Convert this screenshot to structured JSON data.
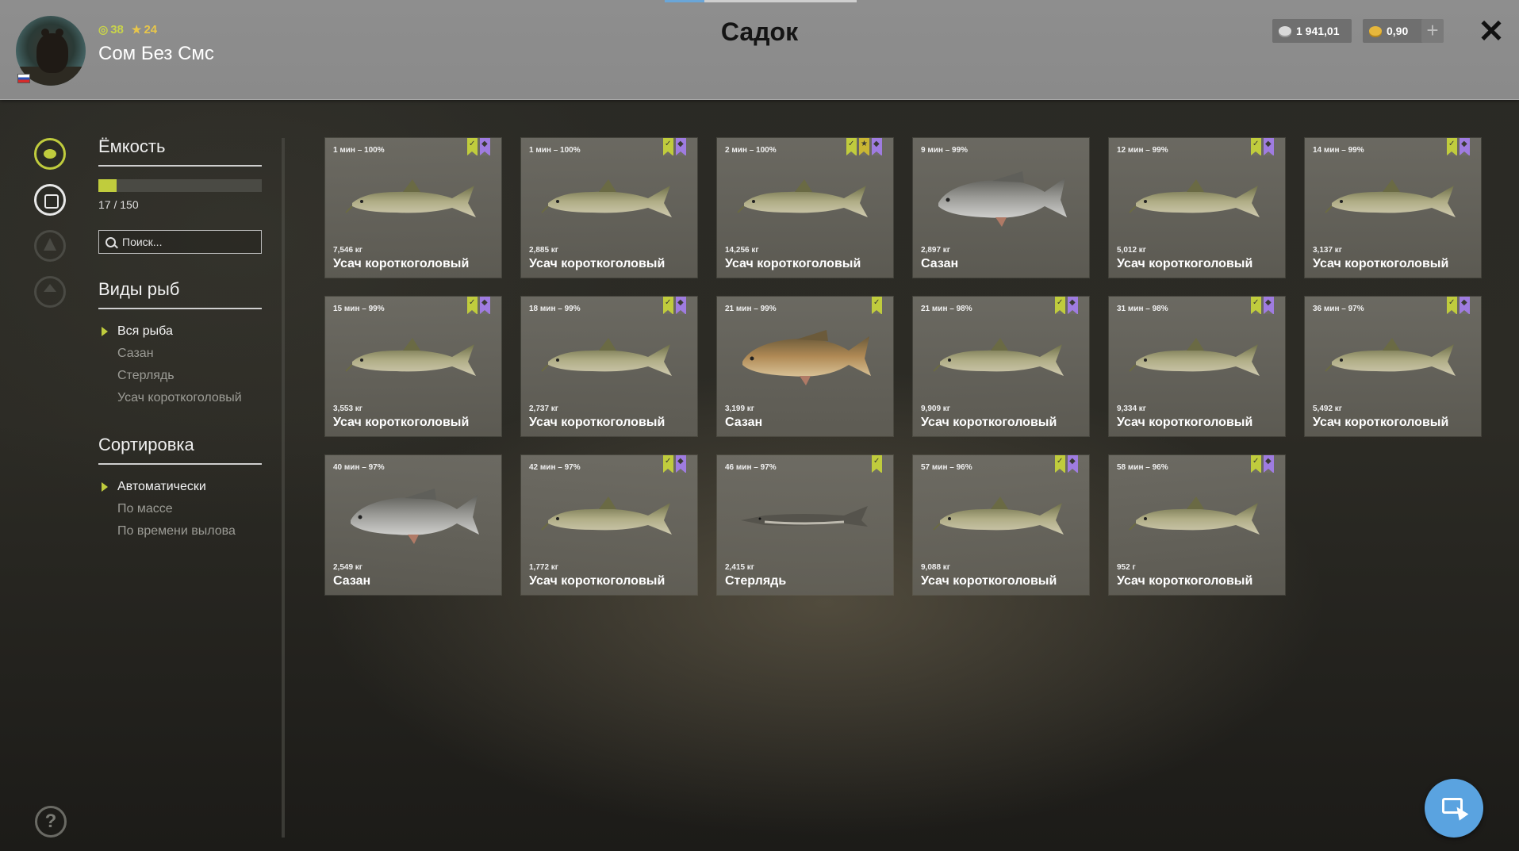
{
  "header": {
    "title": "Садок",
    "player": {
      "name": "Сом Без Смс",
      "level": "38",
      "stars": "24"
    },
    "currency": {
      "silver": "1 941,01",
      "gold": "0,90"
    },
    "add_label": "+",
    "close_label": "✕"
  },
  "sidebar": {
    "capacity": {
      "title": "Ёмкость",
      "value": 17,
      "max": 150,
      "text": "17 / 150",
      "fill_fraction": 0.1133
    },
    "search": {
      "placeholder": "Поиск..."
    },
    "species": {
      "title": "Виды рыб",
      "items": [
        {
          "label": "Вся рыба",
          "active": true
        },
        {
          "label": "Сазан",
          "active": false
        },
        {
          "label": "Стерлядь",
          "active": false
        },
        {
          "label": "Усач короткоголовый",
          "active": false
        }
      ]
    },
    "sorting": {
      "title": "Сортировка",
      "items": [
        {
          "label": "Автоматически",
          "active": true
        },
        {
          "label": "По массе",
          "active": false
        },
        {
          "label": "По времени вылова",
          "active": false
        }
      ]
    },
    "help_label": "?"
  },
  "colors": {
    "accent": "#c0cc3d",
    "badge_purple": "#9f7ce0",
    "badge_gold": "#c9b634",
    "button_blue": "#5aa3e0"
  },
  "fish": [
    {
      "time": "1 мин – 100%",
      "weight": "7,546 кг",
      "name": "Усач короткоголовый",
      "kind": "barbel",
      "badges": [
        "green",
        "purple"
      ]
    },
    {
      "time": "1 мин – 100%",
      "weight": "2,885 кг",
      "name": "Усач короткоголовый",
      "kind": "barbel",
      "badges": [
        "green",
        "purple"
      ]
    },
    {
      "time": "2 мин – 100%",
      "weight": "14,256 кг",
      "name": "Усач короткоголовый",
      "kind": "barbel",
      "badges": [
        "green",
        "gold",
        "purple"
      ]
    },
    {
      "time": "9 мин – 99%",
      "weight": "2,897 кг",
      "name": "Сазан",
      "kind": "carp",
      "badges": []
    },
    {
      "time": "12 мин – 99%",
      "weight": "5,012 кг",
      "name": "Усач короткоголовый",
      "kind": "barbel",
      "badges": [
        "green",
        "purple"
      ]
    },
    {
      "time": "14 мин – 99%",
      "weight": "3,137 кг",
      "name": "Усач короткоголовый",
      "kind": "barbel",
      "badges": [
        "green",
        "purple"
      ]
    },
    {
      "time": "15 мин – 99%",
      "weight": "3,553 кг",
      "name": "Усач короткоголовый",
      "kind": "barbel",
      "badges": [
        "green",
        "purple"
      ]
    },
    {
      "time": "18 мин – 99%",
      "weight": "2,737 кг",
      "name": "Усач короткоголовый",
      "kind": "barbel",
      "badges": [
        "green",
        "purple"
      ]
    },
    {
      "time": "21 мин – 99%",
      "weight": "3,199 кг",
      "name": "Сазан",
      "kind": "carp-golden",
      "badges": [
        "green"
      ]
    },
    {
      "time": "21 мин – 98%",
      "weight": "9,909 кг",
      "name": "Усач короткоголовый",
      "kind": "barbel",
      "badges": [
        "green",
        "purple"
      ]
    },
    {
      "time": "31 мин – 98%",
      "weight": "9,334 кг",
      "name": "Усач короткоголовый",
      "kind": "barbel",
      "badges": [
        "green",
        "purple"
      ]
    },
    {
      "time": "36 мин – 97%",
      "weight": "5,492 кг",
      "name": "Усач короткоголовый",
      "kind": "barbel",
      "badges": [
        "green",
        "purple"
      ]
    },
    {
      "time": "40 мин – 97%",
      "weight": "2,549 кг",
      "name": "Сазан",
      "kind": "carp",
      "badges": []
    },
    {
      "time": "42 мин – 97%",
      "weight": "1,772 кг",
      "name": "Усач короткоголовый",
      "kind": "barbel",
      "badges": [
        "green",
        "purple"
      ]
    },
    {
      "time": "46 мин – 97%",
      "weight": "2,415 кг",
      "name": "Стерлядь",
      "kind": "sterlet",
      "badges": [
        "green"
      ]
    },
    {
      "time": "57 мин – 96%",
      "weight": "9,088 кг",
      "name": "Усач короткоголовый",
      "kind": "barbel",
      "badges": [
        "green",
        "purple"
      ]
    },
    {
      "time": "58 мин – 96%",
      "weight": "952 г",
      "name": "Усач короткоголовый",
      "kind": "barbel",
      "badges": [
        "green",
        "purple"
      ]
    }
  ]
}
